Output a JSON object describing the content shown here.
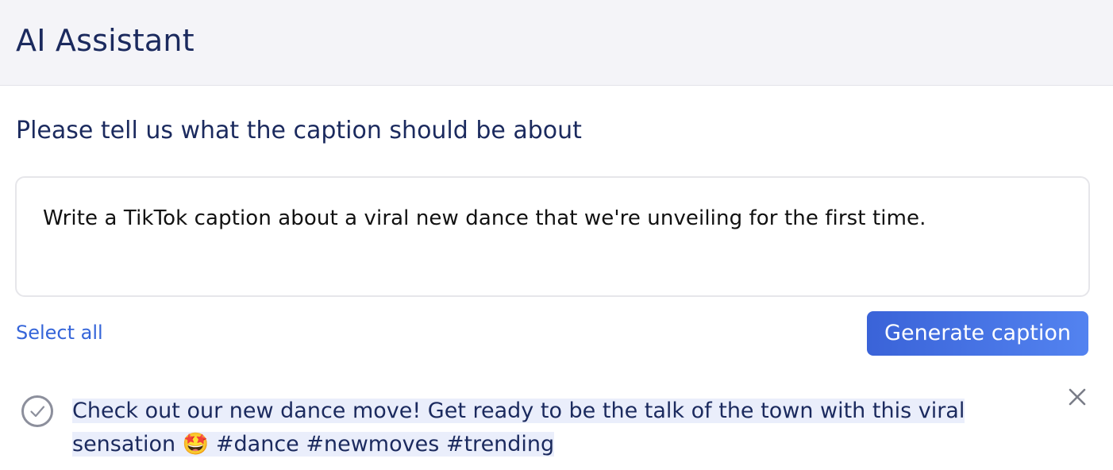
{
  "header": {
    "title": "AI Assistant"
  },
  "prompt": {
    "label": "Please tell us what the caption should be about",
    "value": "Write a TikTok caption about a viral new dance that we're unveiling for the first time."
  },
  "actions": {
    "select_all_label": "Select all",
    "generate_label": "Generate caption"
  },
  "results": [
    {
      "text": "Check out our new dance move! Get ready to be the talk of the town with this viral sensation 🤩 #dance #newmoves #trending",
      "selected": false
    }
  ],
  "colors": {
    "header_bg": "#f4f4f8",
    "primary_text": "#1b2a5e",
    "link": "#3565d9",
    "button_gradient_start": "#3a63d8",
    "button_gradient_end": "#5383f0",
    "result_highlight": "#eaeefb"
  },
  "icons": {
    "result_check": "check-circle-icon",
    "result_close": "close-icon"
  }
}
